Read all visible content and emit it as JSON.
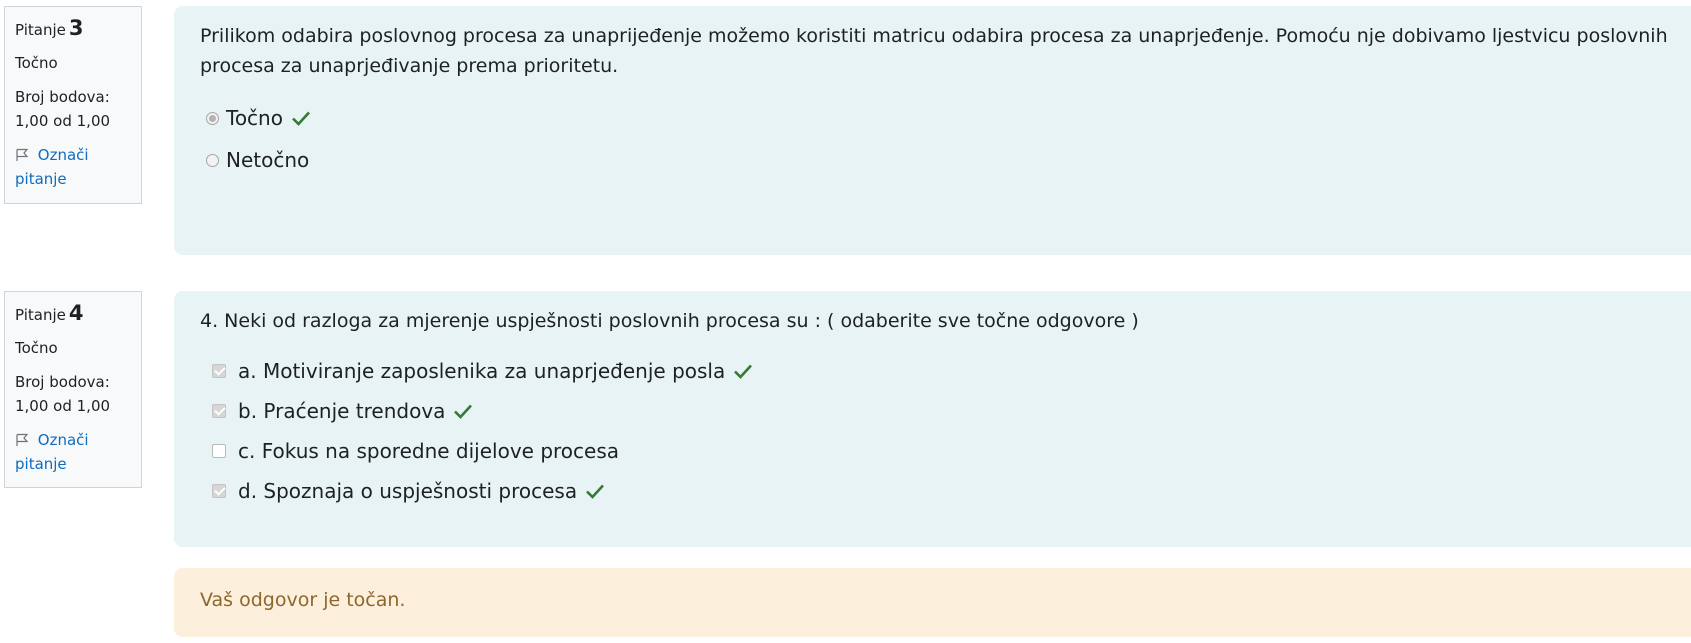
{
  "questions": [
    {
      "label": "Pitanje",
      "number": "3",
      "state": "Točno",
      "grade_label": "Broj bodova:",
      "grade_value": "1,00 od 1,00",
      "flag_label_1": "Označi",
      "flag_label_2": "pitanje",
      "text": "Prilikom odabira poslovnog procesa za unaprijeđenje možemo koristiti matricu odabira procesa za unaprjeđenje. Pomoću nje dobivamo ljestvicu poslovnih procesa za unaprjeđivanje prema prioritetu.",
      "answers": [
        {
          "label": "Točno",
          "selected": true,
          "correct": true
        },
        {
          "label": "Netočno",
          "selected": false,
          "correct": false
        }
      ]
    },
    {
      "label": "Pitanje",
      "number": "4",
      "state": "Točno",
      "grade_label": "Broj bodova:",
      "grade_value": "1,00 od 1,00",
      "flag_label_1": "Označi",
      "flag_label_2": "pitanje",
      "text": "4.  Neki od razloga za mjerenje uspješnosti poslovnih procesa su : ( odaberite sve točne odgovore )",
      "answers": [
        {
          "label": "a. Motiviranje zaposlenika za unaprjeđenje posla",
          "selected": true,
          "correct": true
        },
        {
          "label": "b. Praćenje trendova",
          "selected": true,
          "correct": true
        },
        {
          "label": "c. Fokus na sporedne dijelove procesa",
          "selected": false,
          "correct": false
        },
        {
          "label": "d. Spoznaja o uspješnosti procesa",
          "selected": true,
          "correct": true
        }
      ]
    }
  ],
  "feedback": "Vaš odgovor je točan.",
  "colors": {
    "info_bg": "#f8f9fa",
    "formulation_bg": "#e7f3f5",
    "feedback_bg": "#fcefdc",
    "feedback_text": "#8e662e",
    "link": "#0f6cbf",
    "correct_tick": "#357a32"
  },
  "icons": {
    "flag": "flag-icon",
    "correct": "check-icon"
  }
}
